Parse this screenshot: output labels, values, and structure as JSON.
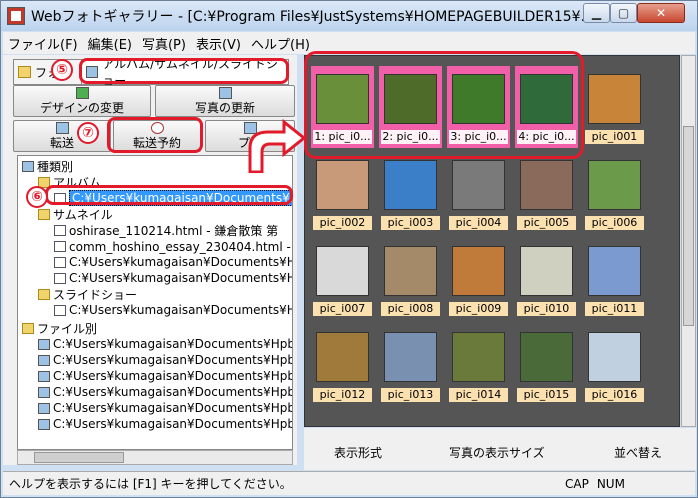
{
  "window": {
    "title": "Webフォトギャラリー - [C:¥Program Files¥JustSystems¥HOMEPAGEBUILDER15¥..."
  },
  "menu": [
    "ファイル(F)",
    "編集(E)",
    "写真(P)",
    "表示(V)",
    "ヘルプ(H)"
  ],
  "tabs": {
    "folder": "フォル",
    "album": "アルバム/サムネイル/スライドショー"
  },
  "buttons": {
    "design": "デザインの変更",
    "update": "写真の更新",
    "transfer": "転送",
    "schedule": "転送予約",
    "preview": "プレ"
  },
  "markers": {
    "m5": "⑤",
    "m6": "⑥",
    "m7": "⑦"
  },
  "tree": {
    "root": "種類別",
    "album": "アルバム",
    "album_item": "C:¥Users¥kumagaisan¥Documents¥Hp",
    "thumbnail": "サムネイル",
    "thumb_items": [
      "oshirase_110214.html - 鎌倉散策 第",
      "comm_hoshino_essay_230404.html - ア",
      "C:¥Users¥kumagaisan¥Documents¥Hp",
      "C:¥Users¥kumagaisan¥Documents¥Hp"
    ],
    "slideshow": "スライドショー",
    "slide_item": "C:¥Users¥kumagaisan¥Documents¥Hp",
    "by_file": "ファイル別",
    "file_items": [
      "C:¥Users¥kumagaisan¥Documents¥Hpbui",
      "C:¥Users¥kumagaisan¥Documents¥Hpbui",
      "C:¥Users¥kumagaisan¥Documents¥Hpbui",
      "C:¥Users¥kumagaisan¥Documents¥Hpbui",
      "C:¥Users¥kumagaisan¥Documents¥Hpbui",
      "C:¥Users¥kumagaisan¥Documents¥Hpbui"
    ]
  },
  "gallery": [
    {
      "label": "1: pic_i0...",
      "selected": true,
      "color": "#6a8f3a"
    },
    {
      "label": "2: pic_i0...",
      "selected": true,
      "color": "#4f6b2a"
    },
    {
      "label": "3: pic_i0...",
      "selected": true,
      "color": "#3f7a2a"
    },
    {
      "label": "4: pic_i0...",
      "selected": true,
      "color": "#2f6a3a"
    },
    {
      "label": "pic_i001",
      "selected": false,
      "color": "#c8853a"
    },
    {
      "label": "pic_i002",
      "selected": false,
      "color": "#c99a7a"
    },
    {
      "label": "pic_i003",
      "selected": false,
      "color": "#3a7fc8"
    },
    {
      "label": "pic_i004",
      "selected": false,
      "color": "#7a7a7a"
    },
    {
      "label": "pic_i005",
      "selected": false,
      "color": "#8a6a5a"
    },
    {
      "label": "pic_i006",
      "selected": false,
      "color": "#6a9a4a"
    },
    {
      "label": "pic_i007",
      "selected": false,
      "color": "#d9d9d9"
    },
    {
      "label": "pic_i008",
      "selected": false,
      "color": "#a58a6a"
    },
    {
      "label": "pic_i009",
      "selected": false,
      "color": "#c07a3a"
    },
    {
      "label": "pic_i010",
      "selected": false,
      "color": "#d0d0c0"
    },
    {
      "label": "pic_i011",
      "selected": false,
      "color": "#7a9ad0"
    },
    {
      "label": "pic_i012",
      "selected": false,
      "color": "#a07a3a"
    },
    {
      "label": "pic_i013",
      "selected": false,
      "color": "#7a90b0"
    },
    {
      "label": "pic_i014",
      "selected": false,
      "color": "#6a7a3a"
    },
    {
      "label": "pic_i015",
      "selected": false,
      "color": "#4a6a3a"
    },
    {
      "label": "pic_i016",
      "selected": false,
      "color": "#c0d0e0"
    }
  ],
  "toolbar": {
    "view": "表示形式",
    "size": "写真の表示サイズ",
    "sort": "並べ替え"
  },
  "status": {
    "help": "ヘルプを表示するには [F1] キーを押してください。",
    "caps": "CAP",
    "num": "NUM"
  }
}
